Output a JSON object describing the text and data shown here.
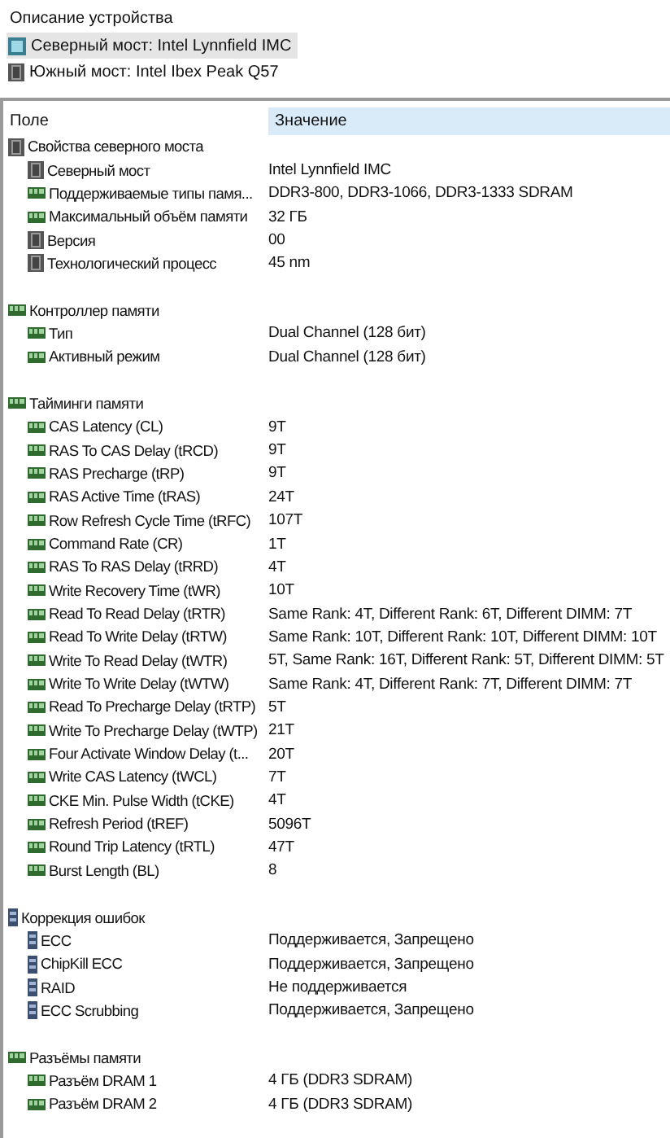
{
  "device_description": {
    "title": "Описание устройства",
    "items": [
      {
        "label": "Северный мост: Intel Lynnfield IMC",
        "kind": "northbridge",
        "selected": true
      },
      {
        "label": "Южный мост: Intel Ibex Peak Q57",
        "kind": "chip",
        "selected": false
      }
    ]
  },
  "table": {
    "columns": [
      {
        "label": "Поле",
        "sorted": false
      },
      {
        "label": "Значение",
        "sorted": true
      }
    ],
    "groups": [
      {
        "label": "Свойства северного моста",
        "kind": "chip",
        "children": [
          {
            "field": "Северный мост",
            "value": "Intel Lynnfield IMC",
            "kind": "chip"
          },
          {
            "field": "Поддерживаемые типы памя...",
            "value": "DDR3-800, DDR3-1066, DDR3-1333 SDRAM",
            "kind": "memory"
          },
          {
            "field": "Максимальный объём памяти",
            "value": "32 ГБ",
            "kind": "memory"
          },
          {
            "field": "Версия",
            "value": "00",
            "kind": "chip"
          },
          {
            "field": "Технологический процесс",
            "value": "45 nm",
            "kind": "chip"
          }
        ]
      },
      {
        "label": "Контроллер памяти",
        "kind": "memory",
        "children": [
          {
            "field": "Тип",
            "value": "Dual Channel  (128 бит)",
            "kind": "memory"
          },
          {
            "field": "Активный режим",
            "value": "Dual Channel  (128 бит)",
            "kind": "memory"
          }
        ]
      },
      {
        "label": "Тайминги памяти",
        "kind": "memory",
        "children": [
          {
            "field": "CAS Latency (CL)",
            "value": "9T",
            "kind": "memory"
          },
          {
            "field": "RAS To CAS Delay (tRCD)",
            "value": "9T",
            "kind": "memory"
          },
          {
            "field": "RAS Precharge (tRP)",
            "value": "9T",
            "kind": "memory"
          },
          {
            "field": "RAS Active Time (tRAS)",
            "value": "24T",
            "kind": "memory"
          },
          {
            "field": "Row Refresh Cycle Time (tRFC)",
            "value": "107T",
            "kind": "memory"
          },
          {
            "field": "Command Rate (CR)",
            "value": "1T",
            "kind": "memory"
          },
          {
            "field": "RAS To RAS Delay (tRRD)",
            "value": "4T",
            "kind": "memory"
          },
          {
            "field": "Write Recovery Time (tWR)",
            "value": "10T",
            "kind": "memory"
          },
          {
            "field": "Read To Read Delay (tRTR)",
            "value": "Same Rank: 4T, Different Rank: 6T, Different DIMM: 7T",
            "kind": "memory"
          },
          {
            "field": "Read To Write Delay (tRTW)",
            "value": "Same Rank: 10T, Different Rank: 10T, Different DIMM: 10T",
            "kind": "memory"
          },
          {
            "field": "Write To Read Delay (tWTR)",
            "value": "5T, Same Rank: 16T, Different Rank: 5T, Different DIMM: 5T",
            "kind": "memory"
          },
          {
            "field": "Write To Write Delay (tWTW)",
            "value": "Same Rank: 4T, Different Rank: 7T, Different DIMM: 7T",
            "kind": "memory"
          },
          {
            "field": "Read To Precharge Delay (tRTP)",
            "value": "5T",
            "kind": "memory"
          },
          {
            "field": "Write To Precharge Delay (tWTP)",
            "value": "21T",
            "kind": "memory"
          },
          {
            "field": "Four Activate Window Delay (t...",
            "value": "20T",
            "kind": "memory"
          },
          {
            "field": "Write CAS Latency (tWCL)",
            "value": "7T",
            "kind": "memory"
          },
          {
            "field": "CKE Min. Pulse Width (tCKE)",
            "value": "4T",
            "kind": "memory"
          },
          {
            "field": "Refresh Period (tREF)",
            "value": "5096T",
            "kind": "memory"
          },
          {
            "field": "Round Trip Latency (tRTL)",
            "value": "47T",
            "kind": "memory"
          },
          {
            "field": "Burst Length (BL)",
            "value": "8",
            "kind": "memory"
          }
        ]
      },
      {
        "label": "Коррекция ошибок",
        "kind": "ecc",
        "children": [
          {
            "field": "ECC",
            "value": "Поддерживается, Запрещено",
            "kind": "ecc"
          },
          {
            "field": "ChipKill ECC",
            "value": "Поддерживается, Запрещено",
            "kind": "ecc"
          },
          {
            "field": "RAID",
            "value": "Не поддерживается",
            "kind": "ecc"
          },
          {
            "field": "ECC Scrubbing",
            "value": "Поддерживается, Запрещено",
            "kind": "ecc"
          }
        ]
      },
      {
        "label": "Разъёмы памяти",
        "kind": "memory",
        "children": [
          {
            "field": "Разъём DRAM 1",
            "value": "4 ГБ  (DDR3 SDRAM)",
            "kind": "memory"
          },
          {
            "field": "Разъём DRAM 2",
            "value": "4 ГБ  (DDR3 SDRAM)",
            "kind": "memory"
          }
        ]
      }
    ]
  }
}
